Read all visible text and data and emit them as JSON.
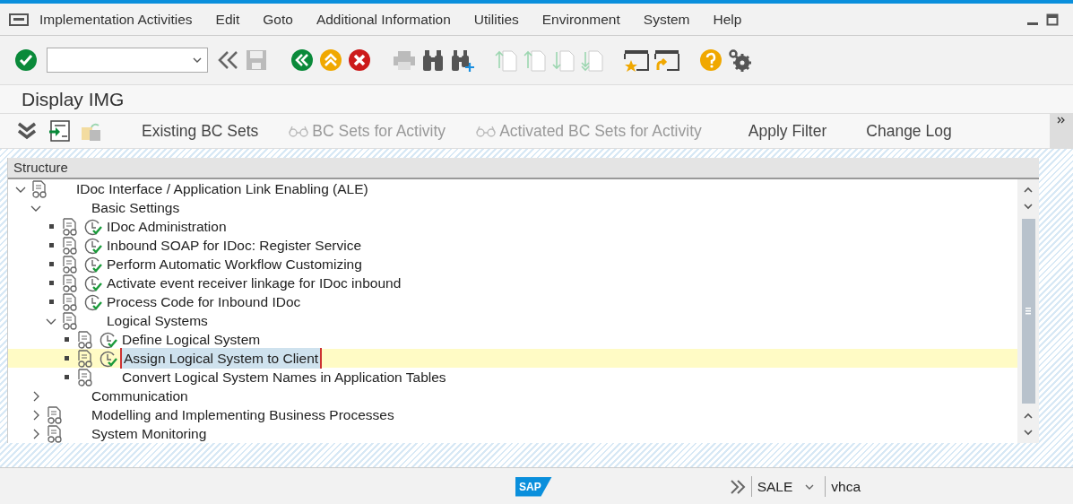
{
  "menu": [
    "Implementation Activities",
    "Edit",
    "Goto",
    "Additional Information",
    "Utilities",
    "Environment",
    "System",
    "Help"
  ],
  "title": "Display IMG",
  "app_toolbar": [
    {
      "label": "Existing BC Sets",
      "disabled": false,
      "glasses": false
    },
    {
      "label": "BC Sets for Activity",
      "disabled": true,
      "glasses": true
    },
    {
      "label": "Activated BC Sets for Activity",
      "disabled": true,
      "glasses": true
    },
    {
      "label": "Apply Filter",
      "disabled": false,
      "glasses": false
    },
    {
      "label": "Change Log",
      "disabled": false,
      "glasses": false
    }
  ],
  "tree": {
    "header": "Structure",
    "nodes": [
      {
        "label": "IDoc Interface / Application Link Enabling (ALE)",
        "doc": true,
        "activity": false,
        "expanded": true,
        "selected": false,
        "children": [
          {
            "label": "Basic Settings",
            "doc": false,
            "activity": false,
            "expanded": true,
            "selected": false,
            "children": [
              {
                "label": "IDoc Administration",
                "doc": true,
                "activity": true,
                "selected": false
              },
              {
                "label": "Inbound SOAP for IDoc: Register Service",
                "doc": true,
                "activity": true,
                "selected": false
              },
              {
                "label": "Perform Automatic Workflow Customizing",
                "doc": true,
                "activity": true,
                "selected": false
              },
              {
                "label": "Activate event receiver linkage for IDoc inbound",
                "doc": true,
                "activity": true,
                "selected": false
              },
              {
                "label": "Process Code for Inbound IDoc",
                "doc": true,
                "activity": true,
                "selected": false
              },
              {
                "label": "Logical Systems",
                "doc": true,
                "activity": false,
                "expanded": true,
                "selected": false,
                "children": [
                  {
                    "label": "Define Logical System",
                    "doc": true,
                    "activity": true,
                    "selected": false
                  },
                  {
                    "label": "Assign Logical System to Client",
                    "doc": true,
                    "activity": true,
                    "selected": true
                  },
                  {
                    "label": "Convert Logical System Names in Application Tables",
                    "doc": true,
                    "activity": false,
                    "selected": false
                  }
                ]
              }
            ]
          },
          {
            "label": "Communication",
            "doc": false,
            "activity": false,
            "expanded": false,
            "selected": false
          },
          {
            "label": "Modelling and Implementing Business Processes",
            "doc": true,
            "activity": false,
            "expanded": false,
            "selected": false
          },
          {
            "label": "System Monitoring",
            "doc": true,
            "activity": false,
            "expanded": false,
            "selected": false
          }
        ]
      }
    ]
  },
  "status_bar": {
    "logo": "SAP",
    "transaction": "SALE",
    "system": "vhca"
  }
}
